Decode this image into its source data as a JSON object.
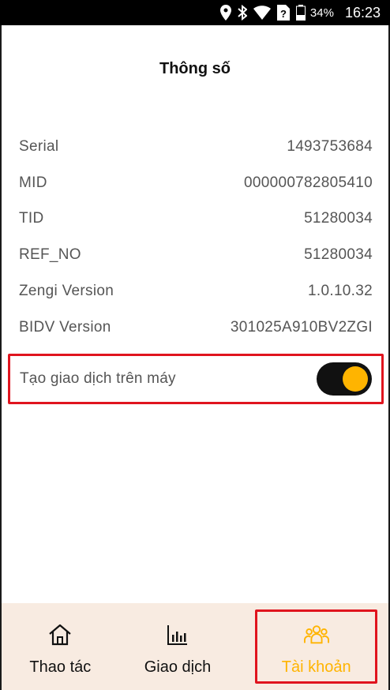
{
  "status_bar": {
    "battery_percent": "34%",
    "time": "16:23",
    "icons": [
      "location-icon",
      "bluetooth-icon",
      "wifi-icon",
      "no-sim-icon",
      "battery-icon"
    ]
  },
  "page": {
    "title": "Thông số"
  },
  "info": [
    {
      "label": "Serial",
      "value": "1493753684"
    },
    {
      "label": "MID",
      "value": "000000782805410"
    },
    {
      "label": "TID",
      "value": "51280034"
    },
    {
      "label": "REF_NO",
      "value": "51280034"
    },
    {
      "label": "Zengi Version",
      "value": "1.0.10.32"
    },
    {
      "label": "BIDV Version",
      "value": "301025A910BV2ZGI"
    }
  ],
  "toggle": {
    "label": "Tạo giao dịch trên máy",
    "on": true
  },
  "nav": {
    "items": [
      {
        "label": "Thao tác",
        "icon": "home-icon"
      },
      {
        "label": "Giao dịch",
        "icon": "chart-icon"
      },
      {
        "label": "Tài khoản",
        "icon": "users-icon",
        "active": true
      }
    ]
  },
  "colors": {
    "accent": "#ffb400",
    "highlight_border": "#e0141e",
    "nav_bg": "#f8ebe1"
  }
}
